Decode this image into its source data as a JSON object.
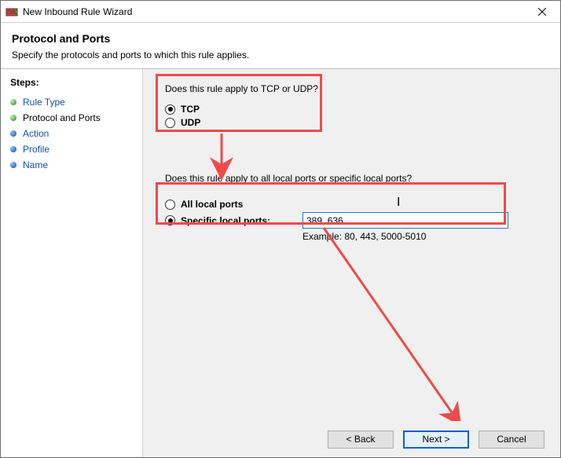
{
  "titlebar": {
    "title": "New Inbound Rule Wizard"
  },
  "header": {
    "heading": "Protocol and Ports",
    "subtitle": "Specify the protocols and ports to which this rule applies."
  },
  "sidebar": {
    "steps_label": "Steps:",
    "items": [
      {
        "label": "Rule Type"
      },
      {
        "label": "Protocol and Ports"
      },
      {
        "label": "Action"
      },
      {
        "label": "Profile"
      },
      {
        "label": "Name"
      }
    ]
  },
  "main": {
    "q1": "Does this rule apply to TCP or UDP?",
    "opt_tcp": "TCP",
    "opt_udp": "UDP",
    "q2": "Does this rule apply to all local ports or specific local ports?",
    "opt_all": "All local ports",
    "opt_specific": "Specific local ports:",
    "port_value": "389, 636",
    "example": "Example: 80, 443, 5000-5010"
  },
  "footer": {
    "back": "< Back",
    "next": "Next >",
    "cancel": "Cancel"
  }
}
